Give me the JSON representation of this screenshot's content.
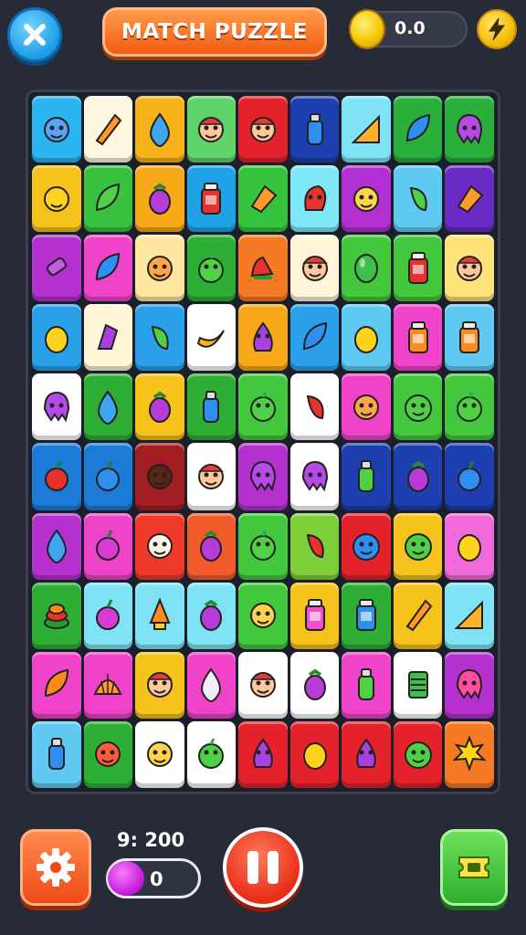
{
  "header": {
    "title": "MATCH PUZZLE",
    "coins": "0.0",
    "close_icon": "close-x-icon",
    "bolt_icon": "lightning-bolt-icon"
  },
  "board": {
    "tiles": [
      [
        "#2bb5f0",
        "face-blue"
      ],
      [
        "#fff7e0",
        "pencil"
      ],
      [
        "#f6b21a",
        "drop-blue"
      ],
      [
        "#5fd46a",
        "face-elf"
      ],
      [
        "#e3222b",
        "face-elf"
      ],
      [
        "#1d3fb0",
        "bottle-blue"
      ],
      [
        "#7fe3f5",
        "ruler"
      ],
      [
        "#2aae3c",
        "leaf-blue"
      ],
      [
        "#2aae3c",
        "octopus-purple"
      ],
      [
        "#f6c21c",
        "coin-face"
      ],
      [
        "#38c23f",
        "leaf-green"
      ],
      [
        "#f7a91a",
        "eggplant"
      ],
      [
        "#1da3e6",
        "jar-red"
      ],
      [
        "#36c43e",
        "chip-orange"
      ],
      [
        "#7ee8f7",
        "dragon-red"
      ],
      [
        "#b22fd1",
        "face-yellow"
      ],
      [
        "#5fc9f2",
        "pepper-green"
      ],
      [
        "#6a2bc4",
        "paper-orange"
      ],
      [
        "#b430cf",
        "candy-purple"
      ],
      [
        "#ef43c9",
        "leaf-blue"
      ],
      [
        "#ffe7a1",
        "face-orange"
      ],
      [
        "#2fae36",
        "apple-green"
      ],
      [
        "#f57a23",
        "shoe-red"
      ],
      [
        "#fff5d9",
        "face-elf"
      ],
      [
        "#43c83d",
        "gem-green"
      ],
      [
        "#43c83d",
        "jar-red"
      ],
      [
        "#fde37a",
        "face-elf"
      ],
      [
        "#2aa0e8",
        "mango-yellow"
      ],
      [
        "#fff5d9",
        "bunch-purple"
      ],
      [
        "#2aa0e8",
        "pepper-green"
      ],
      [
        "#ffffff",
        "banana"
      ],
      [
        "#f7a91a",
        "onion-purple"
      ],
      [
        "#2aa0e8",
        "leaf-blue"
      ],
      [
        "#5fc9f2",
        "mango-yellow"
      ],
      [
        "#ef43c9",
        "jar-orange"
      ],
      [
        "#5fc9f2",
        "jar-orange"
      ],
      [
        "#ffffff",
        "octopus-purple"
      ],
      [
        "#2fae36",
        "drop-blue"
      ],
      [
        "#f6c21c",
        "eggplant"
      ],
      [
        "#2fae36",
        "bottle-blue"
      ],
      [
        "#43c83d",
        "apple-green"
      ],
      [
        "#ffffff",
        "pepper-red"
      ],
      [
        "#ef43c9",
        "face-orange"
      ],
      [
        "#43c83d",
        "blob-green"
      ],
      [
        "#43c83d",
        "apple-green"
      ],
      [
        "#1d7bd8",
        "cherry-red"
      ],
      [
        "#1d7bd8",
        "berry-blue"
      ],
      [
        "#a31e22",
        "face-brown"
      ],
      [
        "#ffffff",
        "face-elf"
      ],
      [
        "#b430cf",
        "octopus-purple"
      ],
      [
        "#ffffff",
        "octopus-purple"
      ],
      [
        "#1d3fb0",
        "bottle-green"
      ],
      [
        "#1d3fb0",
        "eggplant"
      ],
      [
        "#1d3fb0",
        "berry-blue"
      ],
      [
        "#b430cf",
        "drop-blue"
      ],
      [
        "#ef43c9",
        "radish"
      ],
      [
        "#ef3a2b",
        "face-white"
      ],
      [
        "#f25c2a",
        "eggplant"
      ],
      [
        "#43c83d",
        "lime-green"
      ],
      [
        "#7fcf3a",
        "pepper-red"
      ],
      [
        "#e3222b",
        "blob-blue"
      ],
      [
        "#f6c21c",
        "blob-green"
      ],
      [
        "#f06bd9",
        "mango-yellow"
      ],
      [
        "#2fae36",
        "cake"
      ],
      [
        "#7fe3f5",
        "radish"
      ],
      [
        "#7fe3f5",
        "rocket"
      ],
      [
        "#7fe3f5",
        "eggplant"
      ],
      [
        "#43c83d",
        "face-yellow"
      ],
      [
        "#f6c21c",
        "jar-pink"
      ],
      [
        "#2fae36",
        "jar-blue"
      ],
      [
        "#f6c21c",
        "pencil-orange"
      ],
      [
        "#7fe3f5",
        "ruler"
      ],
      [
        "#ef43c9",
        "leaf-orange"
      ],
      [
        "#ef43c9",
        "shell-orange"
      ],
      [
        "#f6c21c",
        "face-elf"
      ],
      [
        "#ef43c9",
        "drop-white"
      ],
      [
        "#ffffff",
        "face-elf"
      ],
      [
        "#ffffff",
        "eggplant"
      ],
      [
        "#ef43c9",
        "bottle-green"
      ],
      [
        "#ffffff",
        "battery"
      ],
      [
        "#b430cf",
        "octopus-pink"
      ],
      [
        "#5fc9f2",
        "bottle-blue"
      ],
      [
        "#2fae36",
        "face-red"
      ],
      [
        "#ffffff",
        "face-yellow"
      ],
      [
        "#ffffff",
        "apple-green"
      ],
      [
        "#e3222b",
        "onion-purple"
      ],
      [
        "#e3222b",
        "lemon-yellow"
      ],
      [
        "#e3222b",
        "grape-purple"
      ],
      [
        "#e3222b",
        "blob-green"
      ],
      [
        "#f57a23",
        "burst-orange"
      ]
    ]
  },
  "footer": {
    "score": "9: 200",
    "progress_value": "0",
    "settings_icon": "gear-icon",
    "pause_icon": "pause-icon",
    "ticket_icon": "ticket-icon"
  }
}
